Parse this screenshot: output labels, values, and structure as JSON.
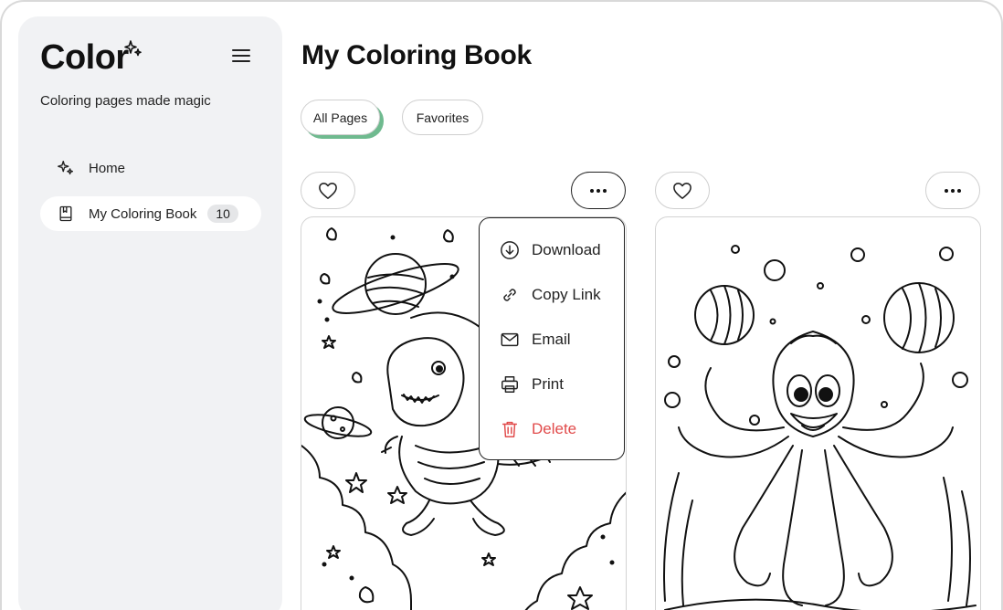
{
  "app": {
    "logo_text": "Color",
    "tagline": "Coloring pages made magic"
  },
  "sidebar": {
    "items": [
      {
        "label": "Home",
        "icon": "sparkle-icon"
      },
      {
        "label": "My Coloring Book",
        "icon": "book-icon",
        "count": "10",
        "active": true
      }
    ]
  },
  "main": {
    "title": "My Coloring Book",
    "tabs": [
      {
        "label": "All Pages",
        "active": true
      },
      {
        "label": "Favorites",
        "active": false
      }
    ],
    "cards": [
      {
        "subject": "dinosaur-astronaut",
        "menu_open": true
      },
      {
        "subject": "octopus-bubbles",
        "menu_open": false
      }
    ]
  },
  "context_menu": {
    "items": [
      {
        "label": "Download",
        "icon": "download-icon"
      },
      {
        "label": "Copy Link",
        "icon": "link-icon"
      },
      {
        "label": "Email",
        "icon": "mail-icon"
      },
      {
        "label": "Print",
        "icon": "printer-icon"
      },
      {
        "label": "Delete",
        "icon": "trash-icon",
        "danger": true
      }
    ]
  },
  "colors": {
    "accent_green": "#6fba8f",
    "danger": "#e14b4b",
    "sidebar_bg": "#f1f2f4"
  }
}
